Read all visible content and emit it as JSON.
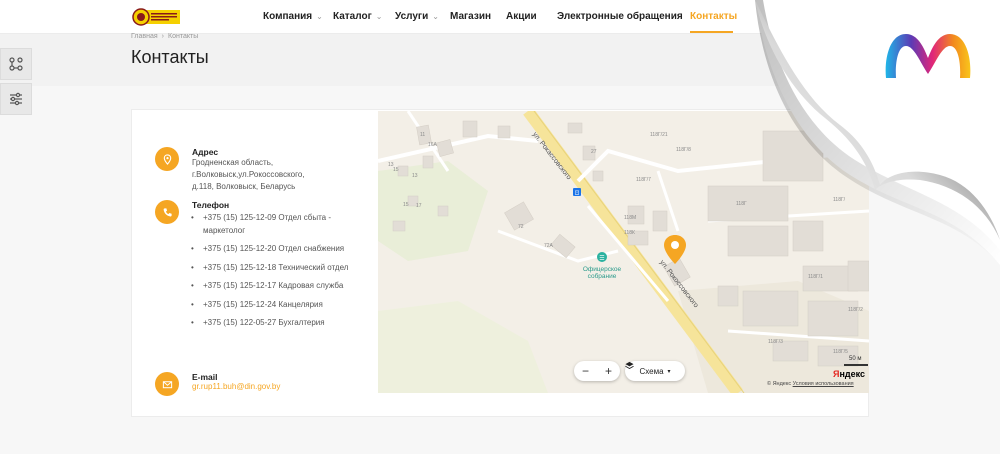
{
  "header": {
    "nav": [
      {
        "label": "Компания",
        "has_dropdown": true
      },
      {
        "label": "Каталог",
        "has_dropdown": true
      },
      {
        "label": "Услуги",
        "has_dropdown": true
      },
      {
        "label": "Магазин",
        "has_dropdown": false
      },
      {
        "label": "Акции",
        "has_dropdown": false
      },
      {
        "label": "Электронные обращения",
        "has_dropdown": false
      },
      {
        "label": "Контакты",
        "has_dropdown": false,
        "active": true
      }
    ]
  },
  "breadcrumb": {
    "home": "Главная",
    "current": "Контакты"
  },
  "page_title": "Контакты",
  "contacts": {
    "address": {
      "label": "Адрес",
      "lines": [
        "Гродненская область,",
        "г.Волковыск,ул.Рокоссовского,",
        "д.118, Волковыск, Беларусь"
      ]
    },
    "phone": {
      "label": "Телефон",
      "items": [
        "+375 (15) 125-12-09 Отдел сбыта - маркетолог",
        "+375 (15) 125-12-20 Отдел снабжения",
        "+375 (15) 125-12-18 Технический отдел",
        "+375 (15) 125-12-17 Кадровая служба",
        "+375 (15) 125-12-24 Канцелярия",
        "+375 (15) 122-05-27 Бухгалтерия"
      ]
    },
    "email": {
      "label": "E-mail",
      "value": "gr.rup11.buh@din.gov.by"
    }
  },
  "map": {
    "street_name_1": "ул. Рокассовского",
    "street_name_2": "ул. Рокоссовского",
    "poi_name_1": "Офицерское",
    "poi_name_2": "собрание",
    "house_numbers": [
      "118Г/21",
      "118Г/",
      "118Г/7",
      "118Г/8",
      "118Г",
      "118Г/3",
      "118Г/1",
      "118Г/2",
      "118Г/3",
      "118Г/5",
      "118М",
      "118К",
      "72",
      "72А",
      "11",
      "16А",
      "13",
      "15",
      "13",
      "15",
      "17",
      "27",
      "19",
      "16",
      "5",
      "11"
    ],
    "zoom_in": "+",
    "zoom_out": "−",
    "layer_button": "Схема",
    "scale": "50 м",
    "provider_logo_1": "Я",
    "provider_logo_2": "ндекс",
    "copyright": "© Яндекс",
    "terms": "Условия использования"
  },
  "colors": {
    "accent": "#f5a623",
    "text": "#222222",
    "muted": "#999999"
  },
  "icons": {
    "address": "map-pin-icon",
    "phone": "phone-icon",
    "email": "mail-icon",
    "side_tool_1": "sitemap-icon",
    "side_tool_2": "sliders-icon"
  }
}
